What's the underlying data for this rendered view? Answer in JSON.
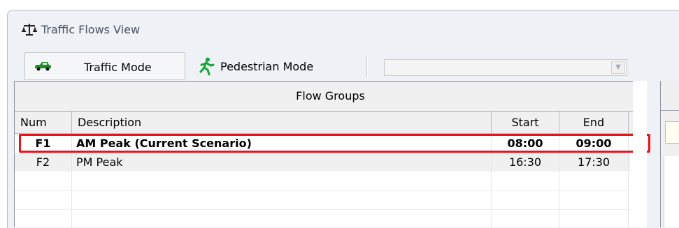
{
  "window": {
    "title": "Traffic Flows View",
    "icon": "scales-icon"
  },
  "toolbar": {
    "traffic_mode_label": "Traffic Mode",
    "traffic_mode_icon": "car-icon",
    "traffic_mode_active": true,
    "pedestrian_mode_label": "Pedestrian Mode",
    "pedestrian_mode_icon": "pedestrian-icon",
    "selector_value": "",
    "selector_disabled": true
  },
  "flow_groups": {
    "header": "Flow Groups",
    "columns": {
      "num": "Num",
      "description": "Description",
      "start": "Start",
      "end": "End"
    },
    "rows": [
      {
        "num": "F1",
        "description": "AM Peak (Current Scenario)",
        "start": "08:00",
        "end": "09:00",
        "current": true
      },
      {
        "num": "F2",
        "description": "PM Peak",
        "start": "16:30",
        "end": "17:30",
        "current": false
      }
    ]
  },
  "colors": {
    "highlight": "#e8141c",
    "car_green": "#1f8a2a",
    "pedestrian_green": "#18a33a"
  }
}
